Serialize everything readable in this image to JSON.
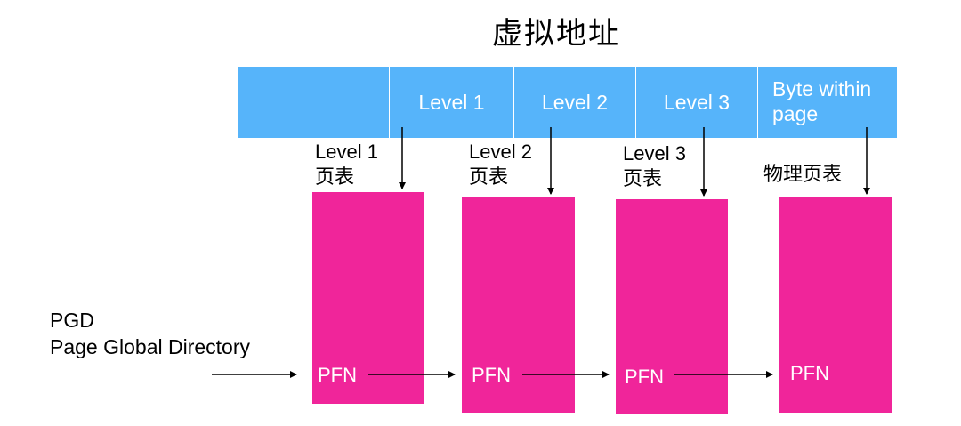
{
  "title": "虚拟地址",
  "virtual_address": {
    "segments": [
      "",
      "Level 1",
      "Level 2",
      "Level 3",
      "Byte within page"
    ]
  },
  "tables": [
    {
      "label": [
        "Level 1",
        "页表"
      ],
      "entry": "PFN"
    },
    {
      "label": [
        "Level 2",
        "页表"
      ],
      "entry": "PFN"
    },
    {
      "label": [
        "Level 3",
        "页表"
      ],
      "entry": "PFN"
    },
    {
      "label": [
        "物理页表"
      ],
      "entry": "PFN"
    }
  ],
  "pgd": {
    "abbr": "PGD",
    "full": "Page Global Directory"
  },
  "colors": {
    "address_bar": "#56b4fa",
    "table": "#f0259a",
    "text_on_color": "#ffffff"
  }
}
